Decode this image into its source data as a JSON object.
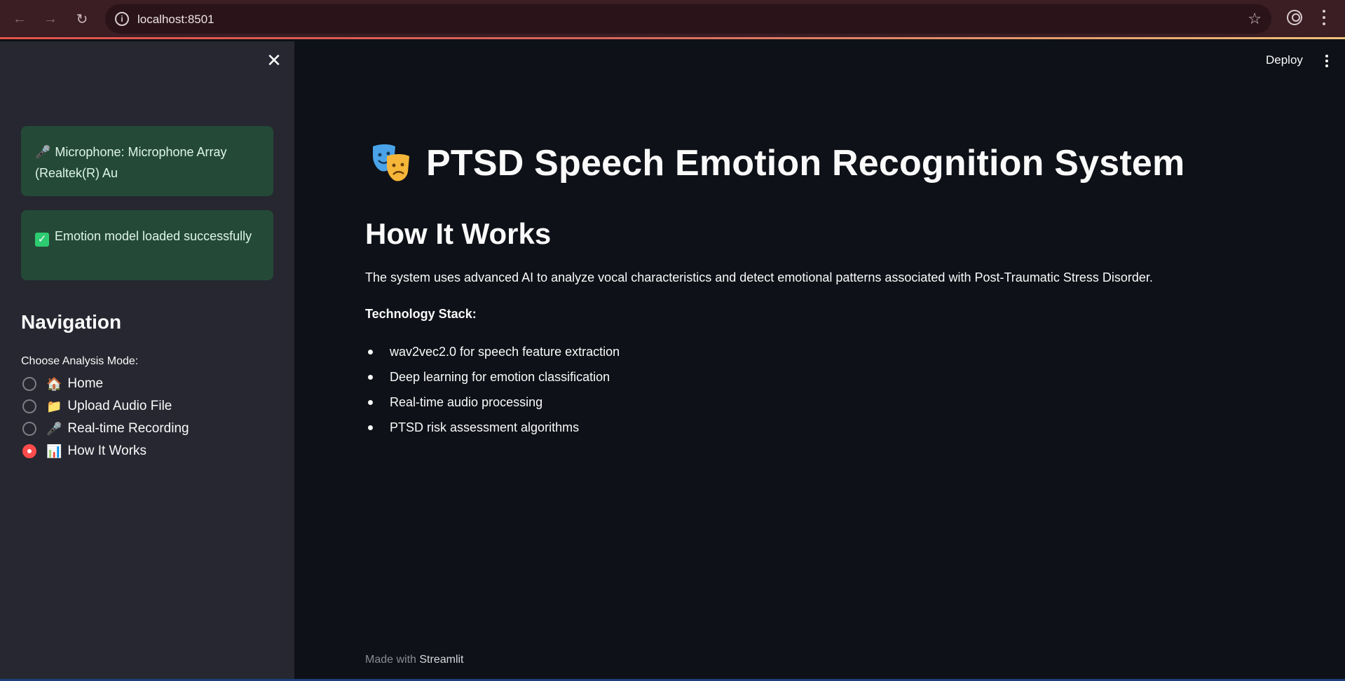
{
  "browser": {
    "url": "localhost:8501"
  },
  "sidebar": {
    "alerts": [
      {
        "icon": "microphone-icon",
        "text": "Microphone: Microphone Array (Realtek(R) Au"
      },
      {
        "icon": "check-icon",
        "text": "Emotion model loaded successfully"
      }
    ],
    "heading": "Navigation",
    "radio_label": "Choose Analysis Mode:",
    "options": [
      {
        "emoji": "🏠",
        "label": "Home",
        "selected": false
      },
      {
        "emoji": "📁",
        "label": "Upload Audio File",
        "selected": false
      },
      {
        "emoji": "🎤",
        "label": "Real-time Recording",
        "selected": false
      },
      {
        "emoji": "📊",
        "label": "How It Works",
        "selected": true
      }
    ]
  },
  "header": {
    "deploy_label": "Deploy"
  },
  "main": {
    "title": "PTSD Speech Emotion Recognition System",
    "section_heading": "How It Works",
    "description": "The system uses advanced AI to analyze vocal characteristics and detect emotional patterns associated with Post-Traumatic Stress Disorder.",
    "stack_heading": "Technology Stack:",
    "stack_items": [
      "wav2vec2.0 for speech feature extraction",
      "Deep learning for emotion classification",
      "Real-time audio processing",
      "PTSD risk assessment algorithms"
    ]
  },
  "footer": {
    "prefix": "Made with",
    "brand": "Streamlit"
  },
  "colors": {
    "accent": "#ff4b4b",
    "success_bg": "#244a37",
    "sidebar_bg": "#262730",
    "main_bg": "#0e1117"
  }
}
